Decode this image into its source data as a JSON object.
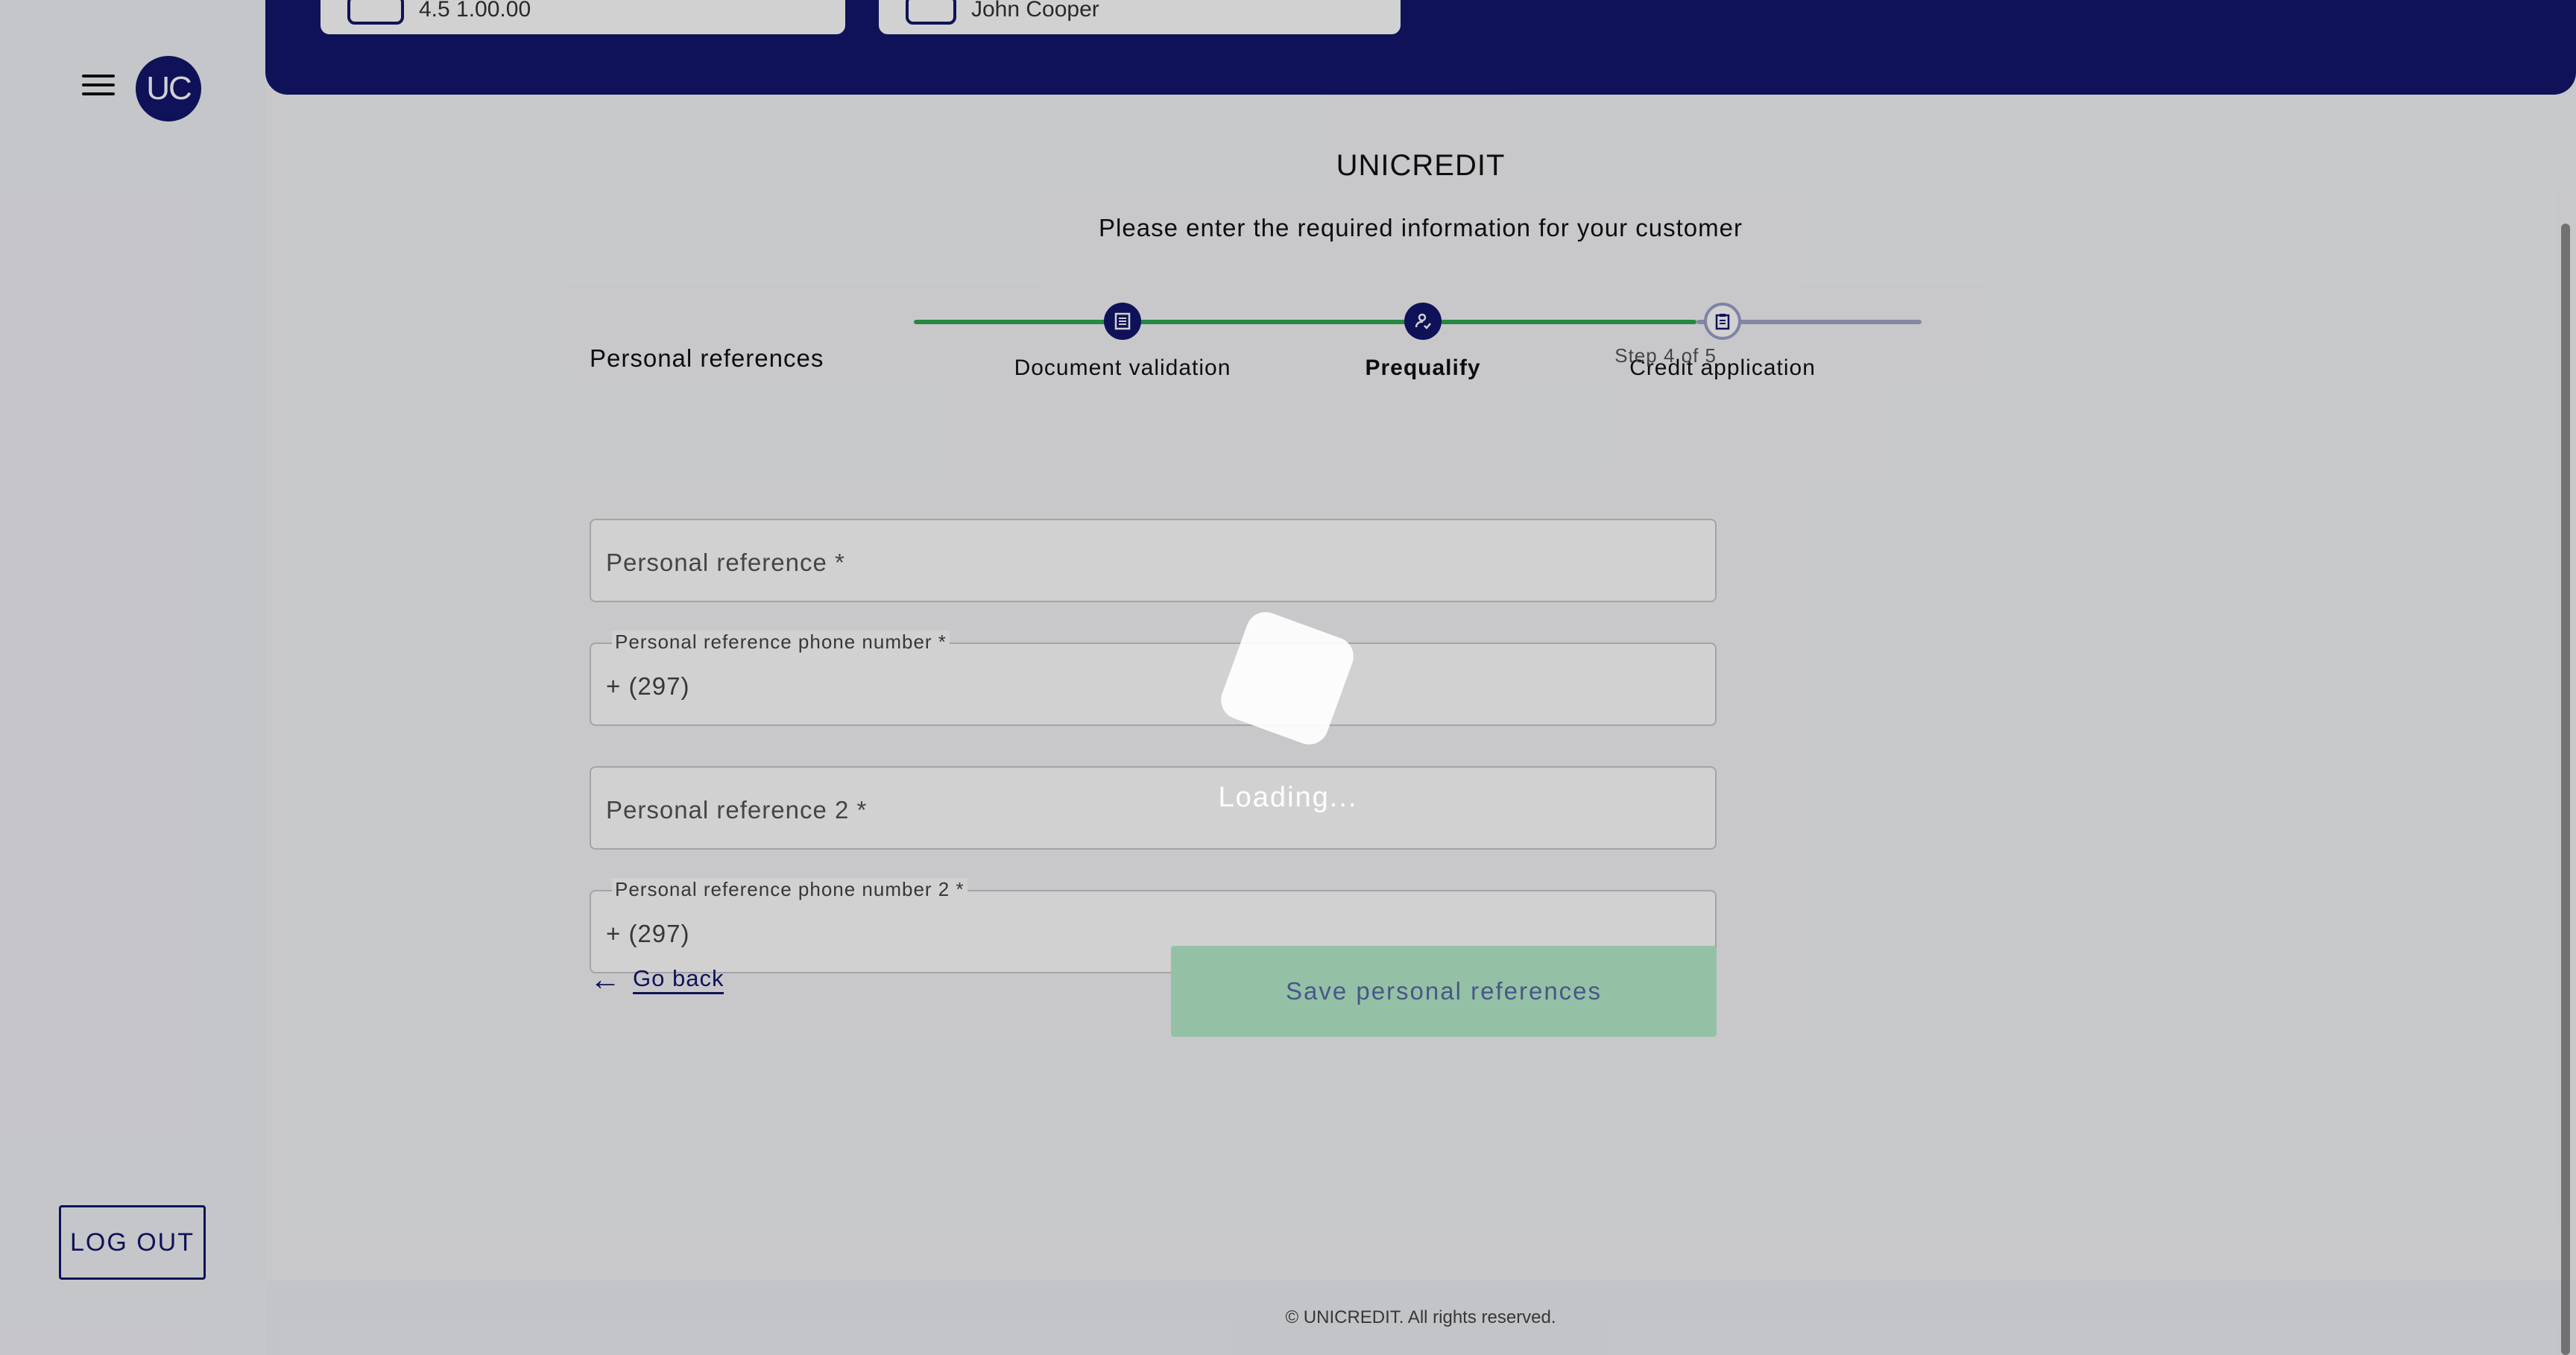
{
  "sidebar": {
    "avatar_initials": "UC",
    "logout_label": "LOG OUT"
  },
  "header": {
    "cards": [
      {
        "text": "4.5 1.00.00"
      },
      {
        "text": "John Cooper"
      }
    ]
  },
  "main": {
    "brand": "UNICREDIT",
    "subtitle": "Please enter the required information for your customer",
    "steps": [
      {
        "label": "Document validation",
        "icon": "document-scan-icon",
        "active": true
      },
      {
        "label": "Prequalify",
        "icon": "user-check-icon",
        "active": true
      },
      {
        "label": "Credit application",
        "icon": "clipboard-icon",
        "active": false
      }
    ],
    "section_title": "Personal references",
    "step_count": "Step 4 of 5",
    "fields": {
      "ref1_placeholder": "Personal reference *",
      "phone1_label": "Personal reference phone number *",
      "phone1_value": "+ (297)",
      "ref2_placeholder": "Personal reference 2 *",
      "phone2_label": "Personal reference phone number 2 *",
      "phone2_value": "+ (297)"
    },
    "go_back_label": "Go back",
    "save_label": "Save personal references"
  },
  "footer": {
    "text": "© UNICREDIT. All rights reserved."
  },
  "overlay": {
    "loading_text": "Loading..."
  },
  "colors": {
    "brand_navy": "#13176c",
    "progress_green": "#2fa84f",
    "save_button_bg": "#b5ecca"
  }
}
